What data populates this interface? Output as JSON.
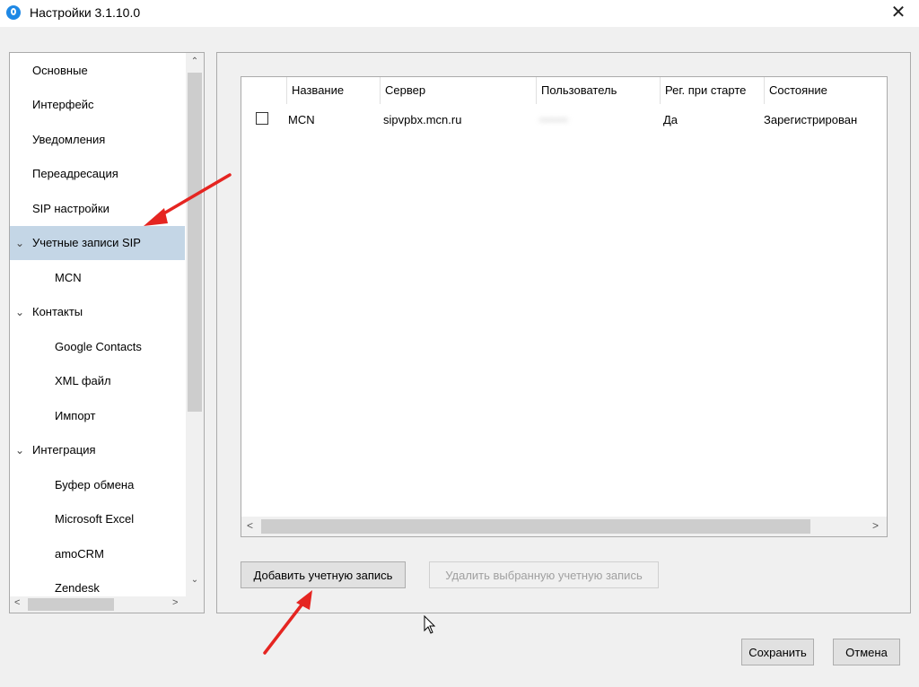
{
  "window": {
    "title": "Настройки 3.1.10.0",
    "close_glyph": "✕"
  },
  "sidebar": {
    "items": [
      {
        "label": "Основные",
        "expandable": false,
        "level": 0
      },
      {
        "label": "Интерфейс",
        "expandable": false,
        "level": 0
      },
      {
        "label": "Уведомления",
        "expandable": false,
        "level": 0
      },
      {
        "label": "Переадресация",
        "expandable": false,
        "level": 0
      },
      {
        "label": "SIP настройки",
        "expandable": false,
        "level": 0
      },
      {
        "label": "Учетные записи SIP",
        "expandable": true,
        "expanded": true,
        "selected": true,
        "level": 0
      },
      {
        "label": "MCN",
        "level": 1
      },
      {
        "label": "Контакты",
        "expandable": true,
        "expanded": true,
        "level": 0
      },
      {
        "label": "Google Contacts",
        "level": 1
      },
      {
        "label": "XML файл",
        "level": 1
      },
      {
        "label": "Импорт",
        "level": 1
      },
      {
        "label": "Интеграция",
        "expandable": true,
        "expanded": true,
        "level": 0
      },
      {
        "label": "Буфер обмена",
        "level": 1
      },
      {
        "label": "Microsoft Excel",
        "level": 1
      },
      {
        "label": "amoCRM",
        "level": 1
      },
      {
        "label": "Zendesk",
        "level": 1
      }
    ]
  },
  "accounts_table": {
    "columns": [
      "Название",
      "Сервер",
      "Пользователь",
      "Рег. при старте",
      "Состояние"
    ],
    "rows": [
      {
        "checked": false,
        "name": "MCN",
        "server": "sipvpbx.mcn.ru",
        "user": "•••••••",
        "reg_on_start": "Да",
        "status": "Зарегистрирован"
      }
    ]
  },
  "buttons": {
    "add_account": "Добавить учетную запись",
    "delete_account": "Удалить выбранную учетную запись",
    "save": "Сохранить",
    "cancel": "Отмена"
  },
  "colors": {
    "selection": "#c4d6e6",
    "annotation_arrow": "#e52521",
    "app_icon": "#1e88e5"
  }
}
